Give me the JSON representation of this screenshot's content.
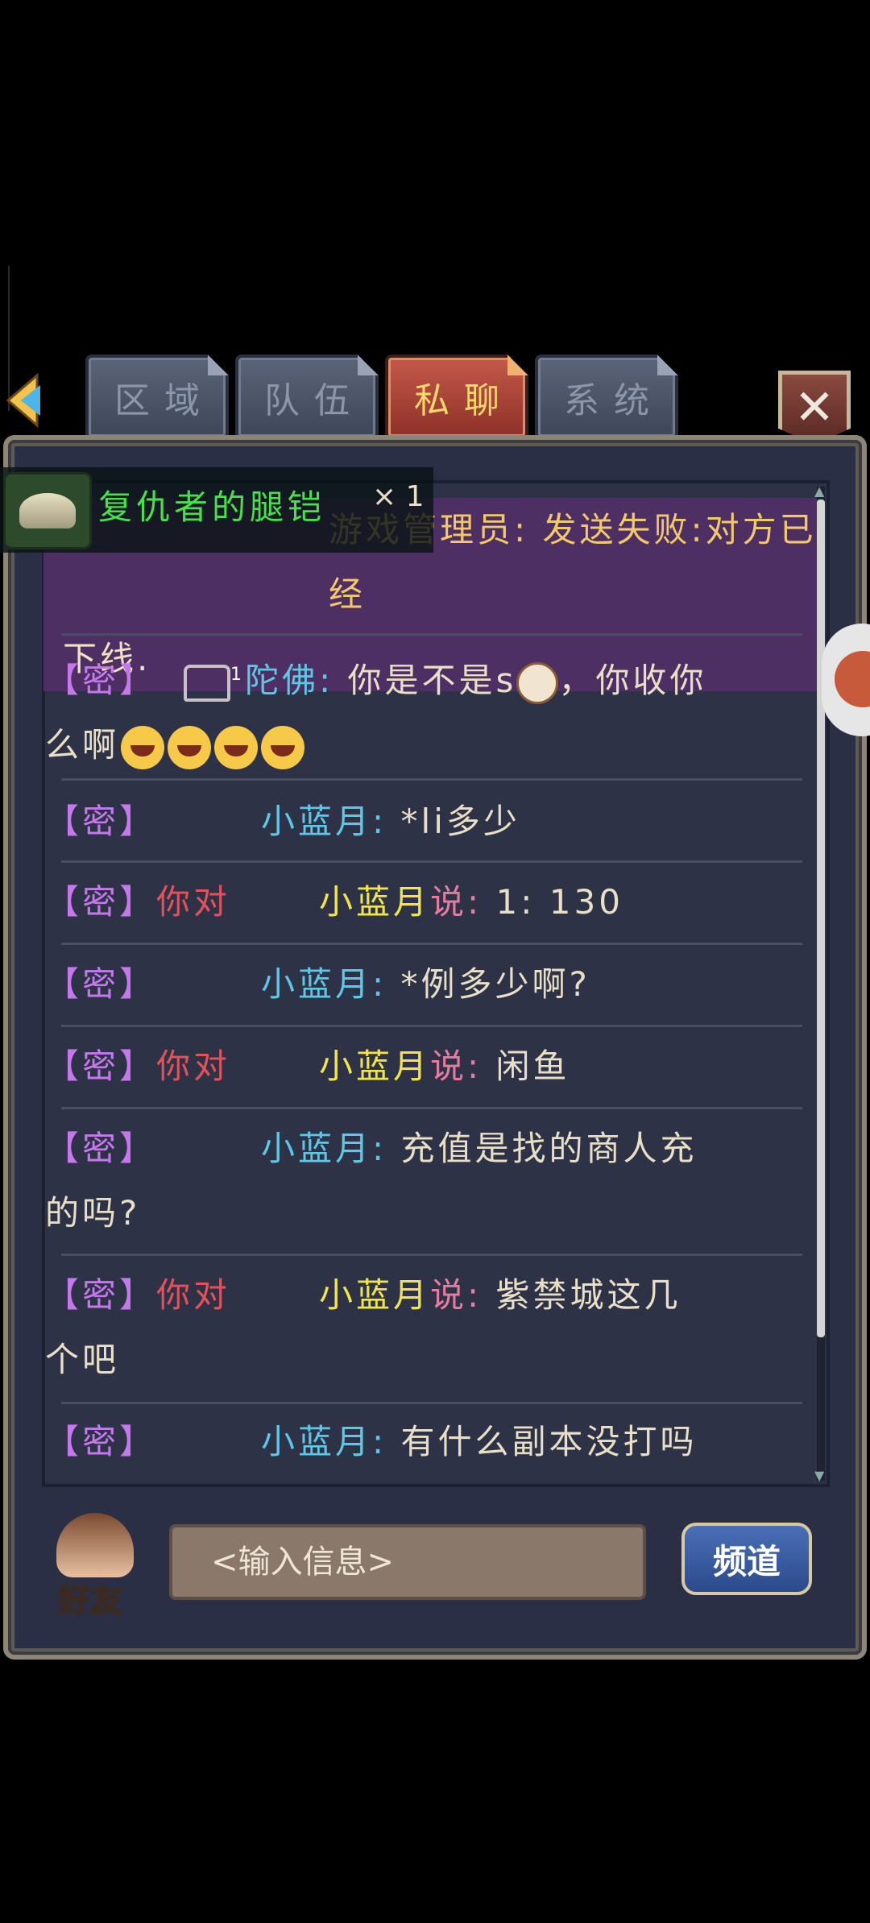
{
  "tabs": [
    {
      "label": "区域",
      "active": false
    },
    {
      "label": "队伍",
      "active": false
    },
    {
      "label": "私聊",
      "active": true
    },
    {
      "label": "系统",
      "active": false
    }
  ],
  "close_label": "✕",
  "item_popup": {
    "name": "复仇者的腿铠",
    "count": "× 1",
    "icon": "leg-armor-icon"
  },
  "messages": [
    {
      "line1": "游戏管理员: 发送失败:对方已经",
      "line2": "下线."
    },
    {
      "tag": "【密】",
      "sender": "陀佛:",
      "badge": "1",
      "text": " 你是不是s",
      "text2": "，你收你",
      "line2": "么啊"
    },
    {
      "tag": "【密】",
      "sender": "小蓝月:",
      "text": " *li多少"
    },
    {
      "tag": "【密】",
      "you": "你对",
      "target": "小蓝月",
      "say": "说:",
      "text": " 1: 130"
    },
    {
      "tag": "【密】",
      "sender": "小蓝月:",
      "text": " *例多少啊?"
    },
    {
      "tag": "【密】",
      "you": "你对",
      "target": "小蓝月",
      "say": "说:",
      "text": " 闲鱼"
    },
    {
      "tag": "【密】",
      "sender": "小蓝月:",
      "text": " 充值是找的商人充",
      "line2": "的吗?"
    },
    {
      "tag": "【密】",
      "you": "你对",
      "target": "小蓝月",
      "say": "说:",
      "text": " 紫禁城这几",
      "line2": "个吧"
    },
    {
      "tag": "【密】",
      "sender": "小蓝月:",
      "text": " 有什么副本没打吗"
    }
  ],
  "bottom": {
    "friends_label": "好友",
    "input_placeholder": "<输入信息>",
    "channel_label": "频道"
  }
}
